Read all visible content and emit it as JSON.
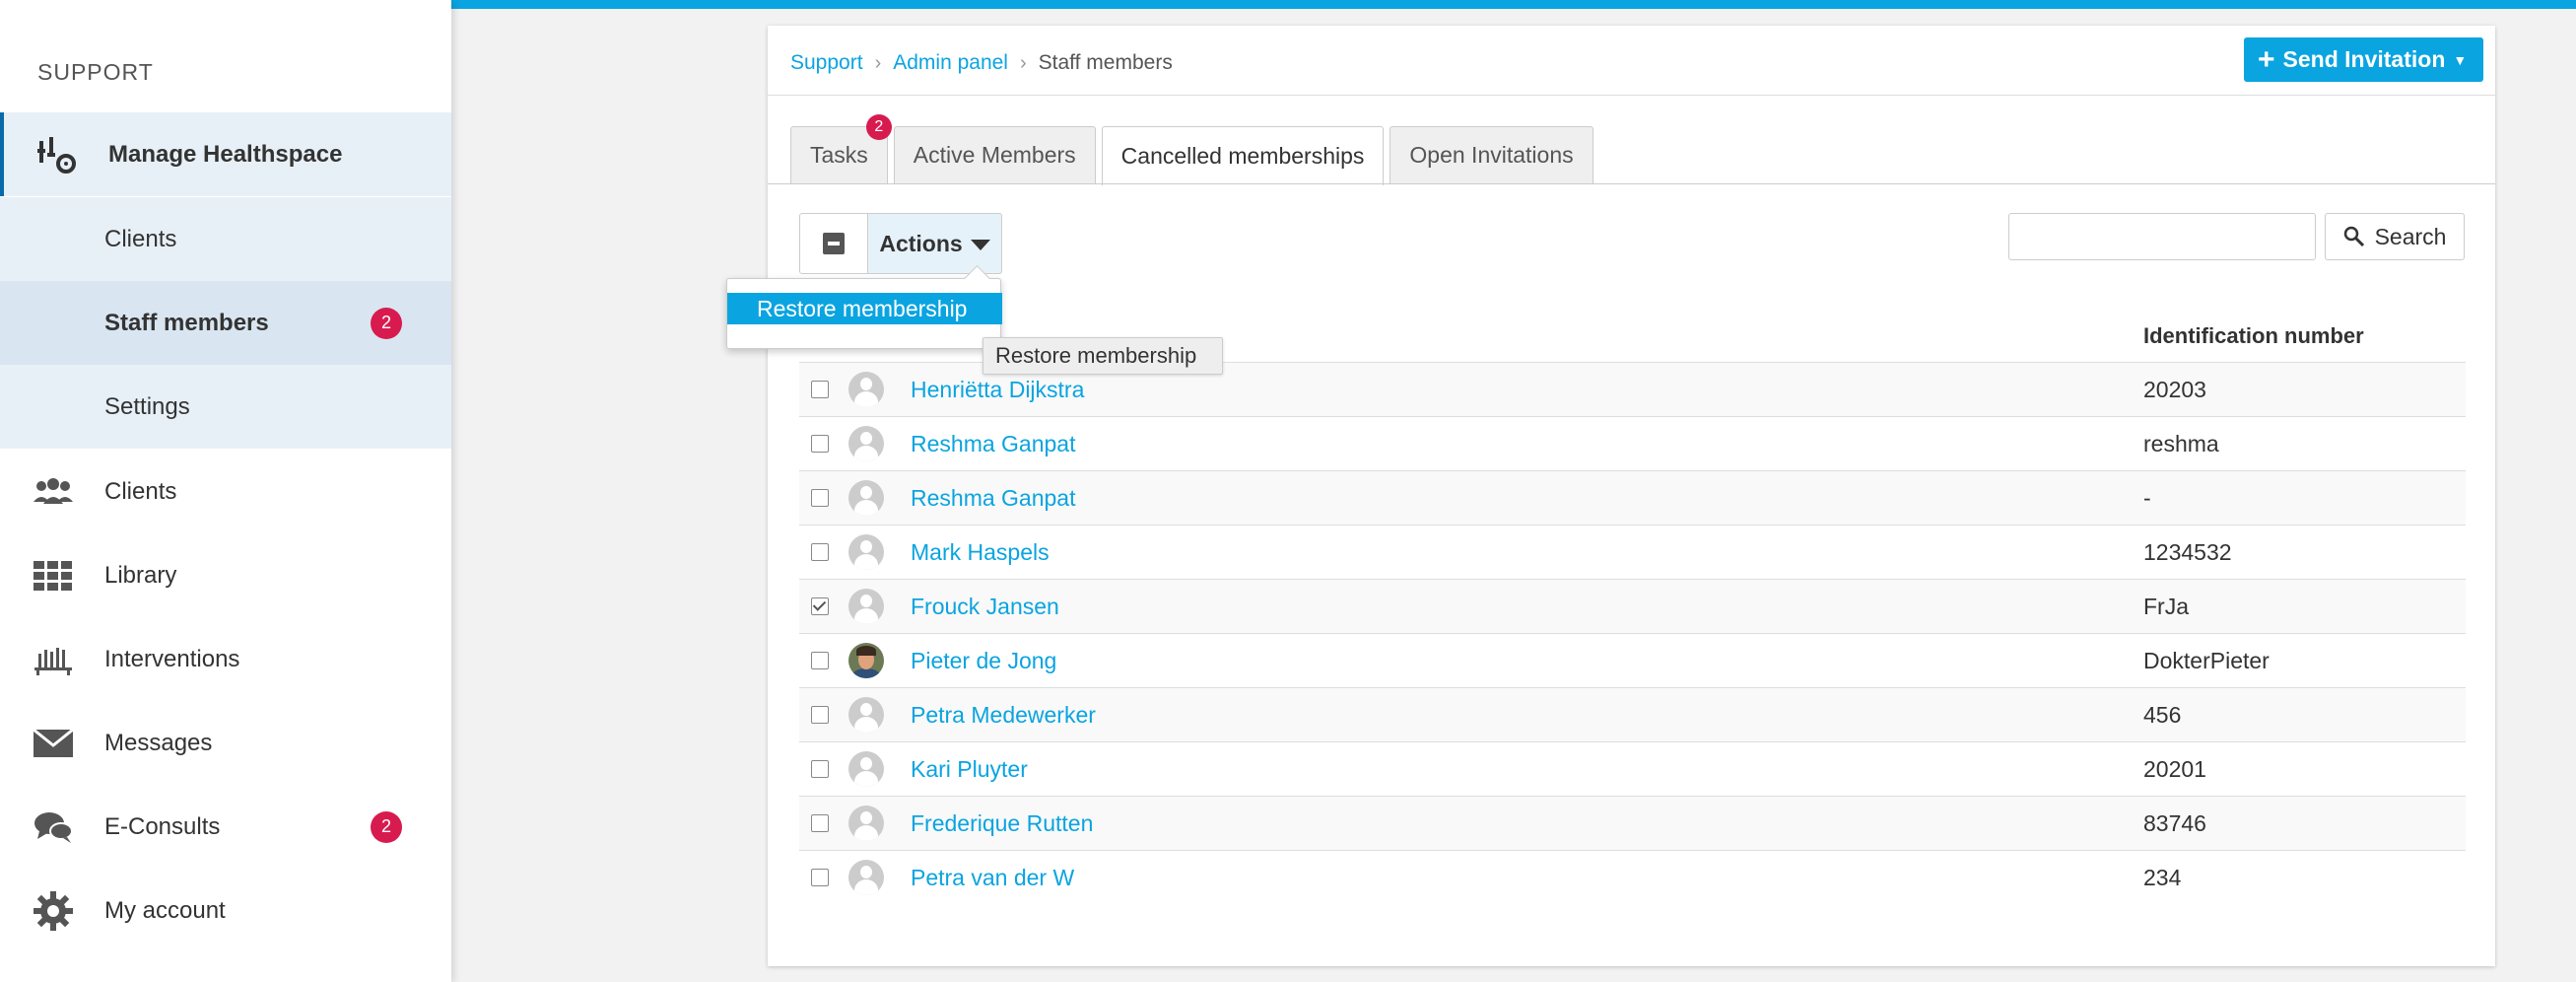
{
  "sidebar": {
    "heading": "SUPPORT",
    "items": [
      {
        "label": "Manage Healthspace",
        "icon": "manage-icon"
      },
      {
        "label": "Clients",
        "sub": true
      },
      {
        "label": "Staff members",
        "sub": true,
        "badge": "2"
      },
      {
        "label": "Settings",
        "sub": true
      },
      {
        "label": "Clients",
        "icon": "people-icon"
      },
      {
        "label": "Library",
        "icon": "grid-icon"
      },
      {
        "label": "Interventions",
        "icon": "books-icon"
      },
      {
        "label": "Messages",
        "icon": "envelope-icon"
      },
      {
        "label": "E-Consults",
        "icon": "chat-icon",
        "badge": "2"
      },
      {
        "label": "My account",
        "icon": "gear-icon"
      }
    ]
  },
  "breadcrumb": {
    "support": "Support",
    "admin": "Admin panel",
    "current": "Staff members",
    "sep": "›"
  },
  "send_invitation": {
    "plus": "+",
    "label": "Send Invitation",
    "caret": "▼"
  },
  "tabs": [
    {
      "label": "Tasks",
      "badge": "2"
    },
    {
      "label": "Active Members"
    },
    {
      "label": "Cancelled memberships",
      "active": true
    },
    {
      "label": "Open Invitations"
    }
  ],
  "actions": {
    "label": "Actions",
    "dropdown_item": "Restore membership",
    "tooltip": "Restore membership"
  },
  "search": {
    "placeholder": "",
    "button": "Search"
  },
  "table": {
    "col_id": "Identification number",
    "rows": [
      {
        "name": "Henriëtta Dijkstra",
        "id": "20203",
        "checked": false
      },
      {
        "name": "Reshma Ganpat",
        "id": "reshma",
        "checked": false
      },
      {
        "name": "Reshma Ganpat",
        "id": "-",
        "checked": false
      },
      {
        "name": "Mark Haspels",
        "id": "1234532",
        "checked": false
      },
      {
        "name": "Frouck Jansen",
        "id": "FrJa",
        "checked": true
      },
      {
        "name": "Pieter de Jong",
        "id": "DokterPieter",
        "checked": false,
        "photo": true
      },
      {
        "name": "Petra Medewerker",
        "id": "456",
        "checked": false
      },
      {
        "name": "Kari Pluyter",
        "id": "20201",
        "checked": false
      },
      {
        "name": "Frederique Rutten",
        "id": "83746",
        "checked": false
      },
      {
        "name": "Petra van der W",
        "id": "234",
        "checked": false
      }
    ]
  },
  "colors": {
    "accent": "#0aa4e0",
    "badge": "#d81b4f",
    "nav_active": "#0b6aa8"
  }
}
